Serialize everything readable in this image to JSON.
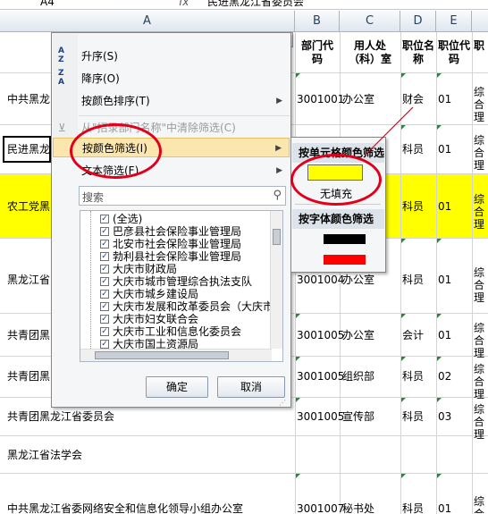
{
  "formula_bar": {
    "name_box": "A4",
    "fx": "fx",
    "content": "民进黑龙江省委员会"
  },
  "columns": [
    "A",
    "B",
    "C",
    "D",
    "E",
    ""
  ],
  "headers": {
    "b": "部门代码",
    "c": "用人处（科）室",
    "d": "职位名称",
    "e": "职位代码",
    "f": "职"
  },
  "rows": [
    {
      "a": "中共黑龙",
      "b": "3001001",
      "c": "办公室",
      "d": "财会",
      "e": "01",
      "f": "综合理"
    },
    {
      "a": "民进黑龙",
      "b": "",
      "c": "",
      "d": "科员",
      "e": "01",
      "f": "综合理"
    },
    {
      "a": "农工党黑",
      "b": "",
      "c": "",
      "d": "科员",
      "e": "01",
      "f": "综合理"
    },
    {
      "a": "黑龙江省",
      "b": "3001004",
      "c": "办公室",
      "d": "科员",
      "e": "01",
      "f": "综合理"
    },
    {
      "a": "共青团黑",
      "b": "3001005",
      "c": "办公室",
      "d": "会计",
      "e": "01",
      "f": "综合理"
    },
    {
      "a": "共青团黑",
      "b": "3001005",
      "c": "组织部",
      "d": "科员",
      "e": "02",
      "f": "综合理"
    },
    {
      "a": "共青团黑龙江省委员会",
      "b": "3001005",
      "c": "宣传部",
      "d": "科员",
      "e": "03",
      "f": "综合理"
    },
    {
      "a": "黑龙江省法学会",
      "b": "",
      "c": "",
      "d": "",
      "e": "",
      "f": ""
    },
    {
      "a": "中共黑龙江省委网络安全和信息化领导小组办公室",
      "b": "3001007",
      "c": "秘书处",
      "d": "科员",
      "e": "01",
      "f": "综合"
    }
  ],
  "menu": {
    "sort_asc": "升序(S)",
    "sort_desc": "降序(O)",
    "sort_color": "按颜色排序(T)",
    "clear_filter": "从\"招录部门名称\"中清除筛选(C)",
    "color_filter": "按颜色筛选(I)",
    "text_filter": "文本筛选(F)",
    "search_placeholder": "搜索",
    "ok": "确定",
    "cancel": "取消"
  },
  "filter_items": [
    "(全选)",
    "巴彦县社会保险事业管理局",
    "北安市社会保险事业管理局",
    "勃利县社会保险事业管理局",
    "大庆市财政局",
    "大庆市城市管理综合执法支队",
    "大庆市城乡建设局",
    "大庆市发展和改革委员会（大庆市",
    "大庆市妇女联合会",
    "大庆市工业和信息化委员会",
    "大庆市国土资源局"
  ],
  "submenu": {
    "cell_color_header": "按单元格颜色筛选",
    "no_fill": "无填充",
    "font_color_header": "按字体颜色筛选",
    "colors": {
      "fill": "#ffff00",
      "font1": "#000000",
      "font2": "#ff0000"
    }
  }
}
